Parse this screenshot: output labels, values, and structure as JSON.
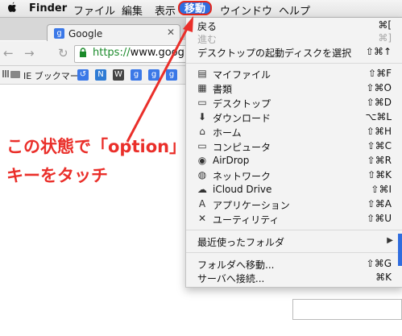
{
  "menubar": {
    "apple_icon": "apple-logo",
    "items": [
      "Finder",
      "ファイル",
      "編集",
      "表示",
      "移動",
      "ウインドウ",
      "ヘルプ"
    ],
    "active_item": "移動",
    "active_color": "#2f6ddf",
    "highlight_border": "#e8281c"
  },
  "browser": {
    "tab_title": "Google",
    "tab_favicon": "g",
    "url_secure": "https://",
    "url_host": "www.google.",
    "bookmark_ie": "IE ブックマーク"
  },
  "menu": {
    "top": [
      {
        "label": "戻る",
        "shortcut": "⌘[",
        "disabled": false
      },
      {
        "label": "進む",
        "shortcut": "⌘]",
        "disabled": true
      },
      {
        "label": "デスクトップの起動ディスクを選択",
        "shortcut": "⇧⌘↑",
        "disabled": false
      }
    ],
    "places": [
      {
        "icon": "my-files-icon",
        "glyph": "▤",
        "label": "マイファイル",
        "shortcut": "⇧⌘F"
      },
      {
        "icon": "documents-icon",
        "glyph": "▦",
        "label": "書類",
        "shortcut": "⇧⌘O"
      },
      {
        "icon": "desktop-icon",
        "glyph": "▭",
        "label": "デスクトップ",
        "shortcut": "⇧⌘D"
      },
      {
        "icon": "downloads-icon",
        "glyph": "⬇",
        "label": "ダウンロード",
        "shortcut": "⌥⌘L"
      },
      {
        "icon": "home-icon",
        "glyph": "⌂",
        "label": "ホーム",
        "shortcut": "⇧⌘H"
      },
      {
        "icon": "computer-icon",
        "glyph": "▭",
        "label": "コンピュータ",
        "shortcut": "⇧⌘C"
      },
      {
        "icon": "airdrop-icon",
        "glyph": "◉",
        "label": "AirDrop",
        "shortcut": "⇧⌘R"
      },
      {
        "icon": "network-icon",
        "glyph": "◍",
        "label": "ネットワーク",
        "shortcut": "⇧⌘K"
      },
      {
        "icon": "icloud-icon",
        "glyph": "☁",
        "label": "iCloud Drive",
        "shortcut": "⇧⌘I"
      },
      {
        "icon": "applications-icon",
        "glyph": "A",
        "label": "アプリケーション",
        "shortcut": "⇧⌘A"
      },
      {
        "icon": "utilities-icon",
        "glyph": "✕",
        "label": "ユーティリティ",
        "shortcut": "⇧⌘U"
      }
    ],
    "recent": {
      "label": "最近使ったフォルダ",
      "arrow": "▶"
    },
    "bottom": [
      {
        "label": "フォルダへ移動...",
        "shortcut": "⇧⌘G"
      },
      {
        "label": "サーバへ接続...",
        "shortcut": "⌘K"
      }
    ]
  },
  "annotation": {
    "line1": "この状態で「option」",
    "line2": "キーをタッチ",
    "color": "#ea2f2a"
  }
}
